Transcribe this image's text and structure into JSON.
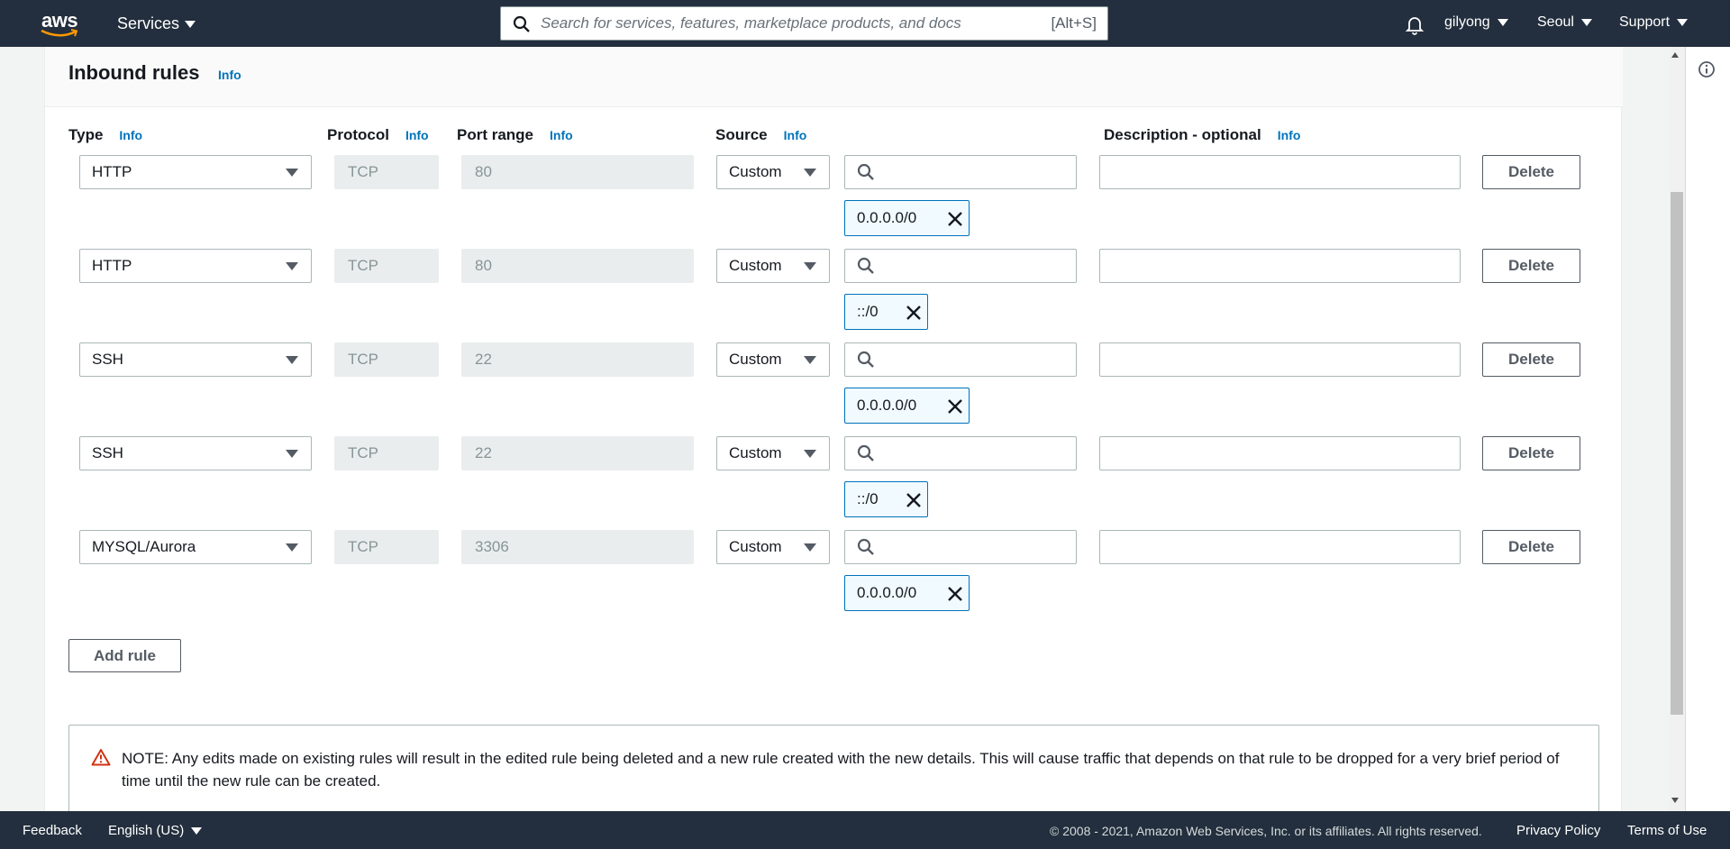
{
  "topnav": {
    "logo_text": "aws",
    "services_label": "Services",
    "search_placeholder": "Search for services, features, marketplace products, and docs",
    "search_shortcut": "[Alt+S]",
    "account": "gilyong",
    "region": "Seoul",
    "support": "Support"
  },
  "panel": {
    "title": "Inbound rules",
    "info": "Info",
    "columns": {
      "type": "Type",
      "protocol": "Protocol",
      "port_range": "Port range",
      "source": "Source",
      "description": "Description - optional"
    },
    "rules": [
      {
        "type": "HTTP",
        "protocol": "TCP",
        "port": "80",
        "source": "Custom",
        "cidr": "0.0.0.0/0",
        "delete": "Delete"
      },
      {
        "type": "HTTP",
        "protocol": "TCP",
        "port": "80",
        "source": "Custom",
        "cidr": "::/0",
        "delete": "Delete"
      },
      {
        "type": "SSH",
        "protocol": "TCP",
        "port": "22",
        "source": "Custom",
        "cidr": "0.0.0.0/0",
        "delete": "Delete"
      },
      {
        "type": "SSH",
        "protocol": "TCP",
        "port": "22",
        "source": "Custom",
        "cidr": "::/0",
        "delete": "Delete"
      },
      {
        "type": "MYSQL/Aurora",
        "protocol": "TCP",
        "port": "3306",
        "source": "Custom",
        "cidr": "0.0.0.0/0",
        "delete": "Delete"
      }
    ],
    "add_rule": "Add rule",
    "note": "NOTE: Any edits made on existing rules will result in the edited rule being deleted and a new rule created with the new details. This will cause traffic that depends on that rule to be dropped for a very brief period of time until the new rule can be created."
  },
  "footer": {
    "feedback": "Feedback",
    "language": "English (US)",
    "copyright": "© 2008 - 2021, Amazon Web Services, Inc. or its affiliates. All rights reserved.",
    "privacy": "Privacy Policy",
    "terms": "Terms of Use"
  },
  "colors": {
    "nav_bg": "#232f3e",
    "link": "#0073bb",
    "warning": "#d13212"
  }
}
